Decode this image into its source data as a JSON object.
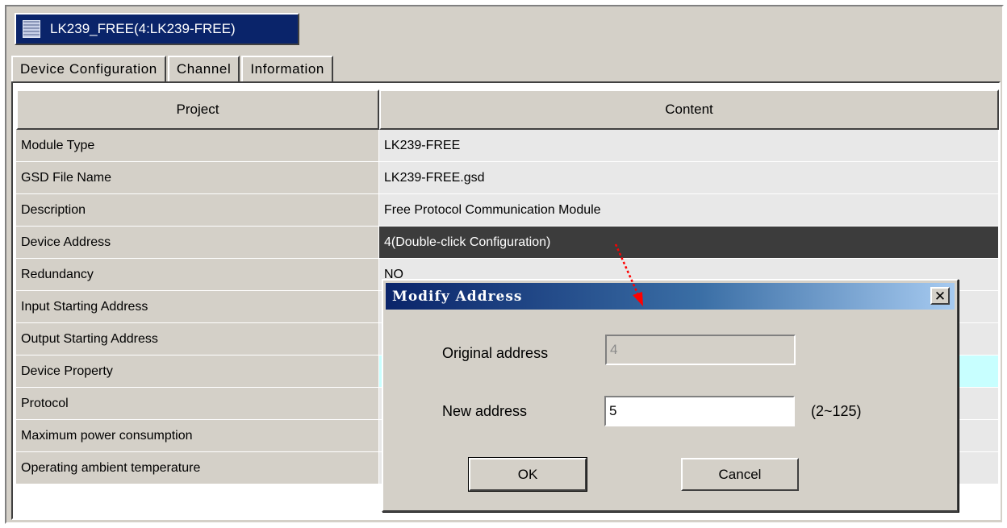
{
  "window": {
    "tab_title": "LK239_FREE(4:LK239-FREE)",
    "tab_icon": "module-icon"
  },
  "tabs": [
    {
      "label": "Device Configuration",
      "active": true
    },
    {
      "label": "Channel",
      "active": false
    },
    {
      "label": "Information",
      "active": false
    }
  ],
  "grid": {
    "headers": {
      "project": "Project",
      "content": "Content"
    },
    "rows": [
      {
        "project": "Module Type",
        "content": "LK239-FREE"
      },
      {
        "project": "GSD File Name",
        "content": "LK239-FREE.gsd"
      },
      {
        "project": "Description",
        "content": "Free Protocol Communication Module"
      },
      {
        "project": "Device Address",
        "content": "4(Double-click Configuration)",
        "selected": true
      },
      {
        "project": "Redundancy",
        "content": "NO"
      },
      {
        "project": "Input Starting Address",
        "content": ""
      },
      {
        "project": "Output Starting Address",
        "content": ""
      },
      {
        "project": "Device Property",
        "content": ""
      },
      {
        "project": "Protocol",
        "content": ""
      },
      {
        "project": "Maximum power consumption",
        "content": ""
      },
      {
        "project": "Operating ambient temperature",
        "content": ""
      }
    ]
  },
  "dialog": {
    "title": "Modify Address",
    "close_icon": "close-icon",
    "original_label": "Original address",
    "original_value": "4",
    "new_label": "New address",
    "new_value": "5",
    "range_hint": "(2~125)",
    "ok_label": "OK",
    "cancel_label": "Cancel"
  },
  "colors": {
    "selection": "#3c3c3c",
    "highlight_row": "#c8ffff",
    "title_gradient_start": "#0a246a",
    "title_gradient_end": "#a6caf0",
    "annotation_arrow": "#ff0000"
  }
}
